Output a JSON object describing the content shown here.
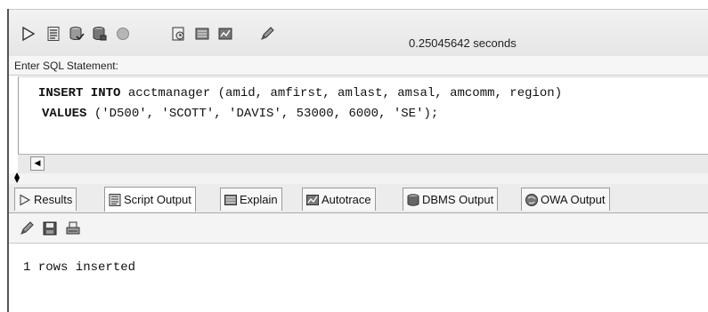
{
  "toolbar": {
    "timing": "0.25045642 seconds",
    "buttons": [
      {
        "name": "execute-statement-icon"
      },
      {
        "name": "run-script-icon"
      },
      {
        "name": "commit-icon"
      },
      {
        "name": "rollback-icon"
      },
      {
        "name": "cancel-icon"
      },
      {
        "name": "sql-history-icon"
      },
      {
        "name": "explain-plan-icon"
      },
      {
        "name": "autotrace-icon"
      },
      {
        "name": "clear-icon"
      }
    ]
  },
  "editor": {
    "label": "Enter SQL Statement:",
    "line1": {
      "keyword": "INSERT INTO",
      "rest": " acctmanager (amid, amfirst, amlast, amsal, amcomm, region)"
    },
    "line2": {
      "keyword": "VALUES",
      "rest": " ('D500', 'SCOTT', 'DAVIS', 53000, 6000, 'SE');"
    }
  },
  "tabs": [
    {
      "label": "Results",
      "icon": "play-icon",
      "active": false
    },
    {
      "label": "Script Output",
      "icon": "script-icon",
      "active": true
    },
    {
      "label": "Explain",
      "icon": "explain-icon",
      "active": false
    },
    {
      "label": "Autotrace",
      "icon": "autotrace-icon",
      "active": false
    },
    {
      "label": "DBMS Output",
      "icon": "dbms-icon",
      "active": false
    },
    {
      "label": "OWA Output",
      "icon": "owa-icon",
      "active": false
    }
  ],
  "output_toolbar": {
    "buttons": [
      {
        "name": "eraser-icon"
      },
      {
        "name": "save-icon"
      },
      {
        "name": "print-icon"
      }
    ]
  },
  "output": {
    "text": "1 rows inserted"
  },
  "colors": {
    "toolbar_bg": "#ececec",
    "panel_border": "#9a9a9a",
    "icon_gray": "#6a6a6a"
  }
}
